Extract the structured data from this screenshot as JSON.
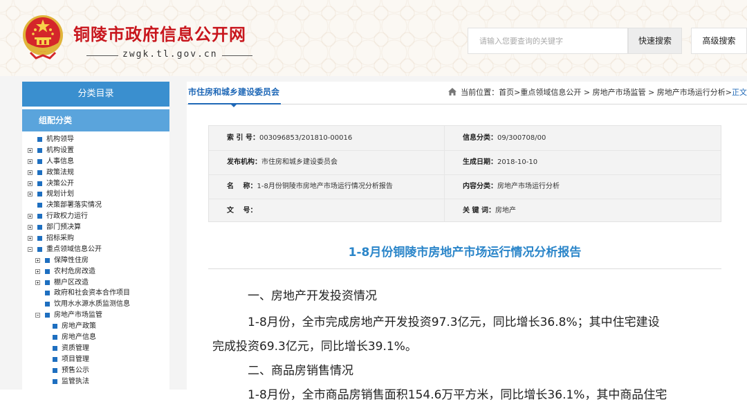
{
  "header": {
    "site_title": "铜陵市政府信息公开网",
    "site_domain": "zwgk.tl.gov.cn",
    "search_placeholder": "请输入您要查询的关键字",
    "quick_search_label": "快速搜索",
    "advanced_search_label": "高级搜索"
  },
  "sidebar": {
    "category_title": "分类目录",
    "sub_category_title": "组配分类",
    "items": [
      {
        "label": "机构领导",
        "expander": "none",
        "depth": 0
      },
      {
        "label": "机构设置",
        "expander": "plus",
        "depth": 0
      },
      {
        "label": "人事信息",
        "expander": "plus",
        "depth": 0
      },
      {
        "label": "政策法规",
        "expander": "plus",
        "depth": 0
      },
      {
        "label": "决策公开",
        "expander": "plus",
        "depth": 0
      },
      {
        "label": "规划计划",
        "expander": "plus",
        "depth": 0
      },
      {
        "label": "决策部署落实情况",
        "expander": "none",
        "depth": 0
      },
      {
        "label": "行政权力运行",
        "expander": "plus",
        "depth": 0
      },
      {
        "label": "部门预决算",
        "expander": "plus",
        "depth": 0
      },
      {
        "label": "招标采购",
        "expander": "plus",
        "depth": 0
      },
      {
        "label": "重点领域信息公开",
        "expander": "minus",
        "depth": 0
      },
      {
        "label": "保障性住房",
        "expander": "plus",
        "depth": 1
      },
      {
        "label": "农村危房改造",
        "expander": "plus",
        "depth": 1
      },
      {
        "label": "棚户区改造",
        "expander": "plus",
        "depth": 1
      },
      {
        "label": "政府和社会资本合作项目",
        "expander": "none",
        "depth": 1
      },
      {
        "label": "饮用水水源水质监测信息",
        "expander": "none",
        "depth": 1
      },
      {
        "label": "房地产市场监管",
        "expander": "minus",
        "depth": 1
      },
      {
        "label": "房地产政策",
        "expander": "none",
        "depth": 2
      },
      {
        "label": "房地产信息",
        "expander": "none",
        "depth": 2
      },
      {
        "label": "资质管理",
        "expander": "none",
        "depth": 2
      },
      {
        "label": "项目管理",
        "expander": "none",
        "depth": 2
      },
      {
        "label": "预售公示",
        "expander": "none",
        "depth": 2
      },
      {
        "label": "监管执法",
        "expander": "none",
        "depth": 2
      }
    ]
  },
  "main": {
    "tab_label": "市住房和城乡建设委员会",
    "breadcrumb": {
      "prefix": "当前位置：",
      "path": "首页>重点领域信息公开 > 房地产市场监管 > 房地产市场运行分析>",
      "current": "正文"
    },
    "meta": {
      "index_label": "索 引 号：",
      "index_value": "003096853/201810-00016",
      "info_category_label": "信息分类：",
      "info_category_value": "09/300708/00",
      "publisher_label": "发布机构：",
      "publisher_value": "市住房和城乡建设委员会",
      "date_label": "生成日期：",
      "date_value": "2018-10-10",
      "name_label": "名　 称：",
      "name_value": "1-8月份铜陵市房地产市场运行情况分析报告",
      "content_category_label": "内容分类：",
      "content_category_value": "房地产市场运行分析",
      "doc_no_label": "文　 号：",
      "doc_no_value": "",
      "keywords_label": "关 键 词：",
      "keywords_value": "房地产"
    },
    "article": {
      "title": "1-8月份铜陵市房地产市场运行情况分析报告",
      "heading1": "一、房地产开发投资情况",
      "para1_line1": "1-8月份，全市完成房地产开发投资97.3亿元，同比增长36.8%；其中住宅建设",
      "para1_line2": "完成投资69.3亿元，同比增长39.1%。",
      "heading2": "二、商品房销售情况",
      "para2_line1": "1-8月份，全市商品房销售面积154.6万平方米，同比增长36.1%，其中商品住宅"
    }
  },
  "colors": {
    "brand_red": "#c8161d",
    "nav_blue": "#3a8fcf",
    "nav_blue_light": "#5aa4dc",
    "link_blue": "#1f68b7",
    "title_blue": "#2a85c9"
  }
}
